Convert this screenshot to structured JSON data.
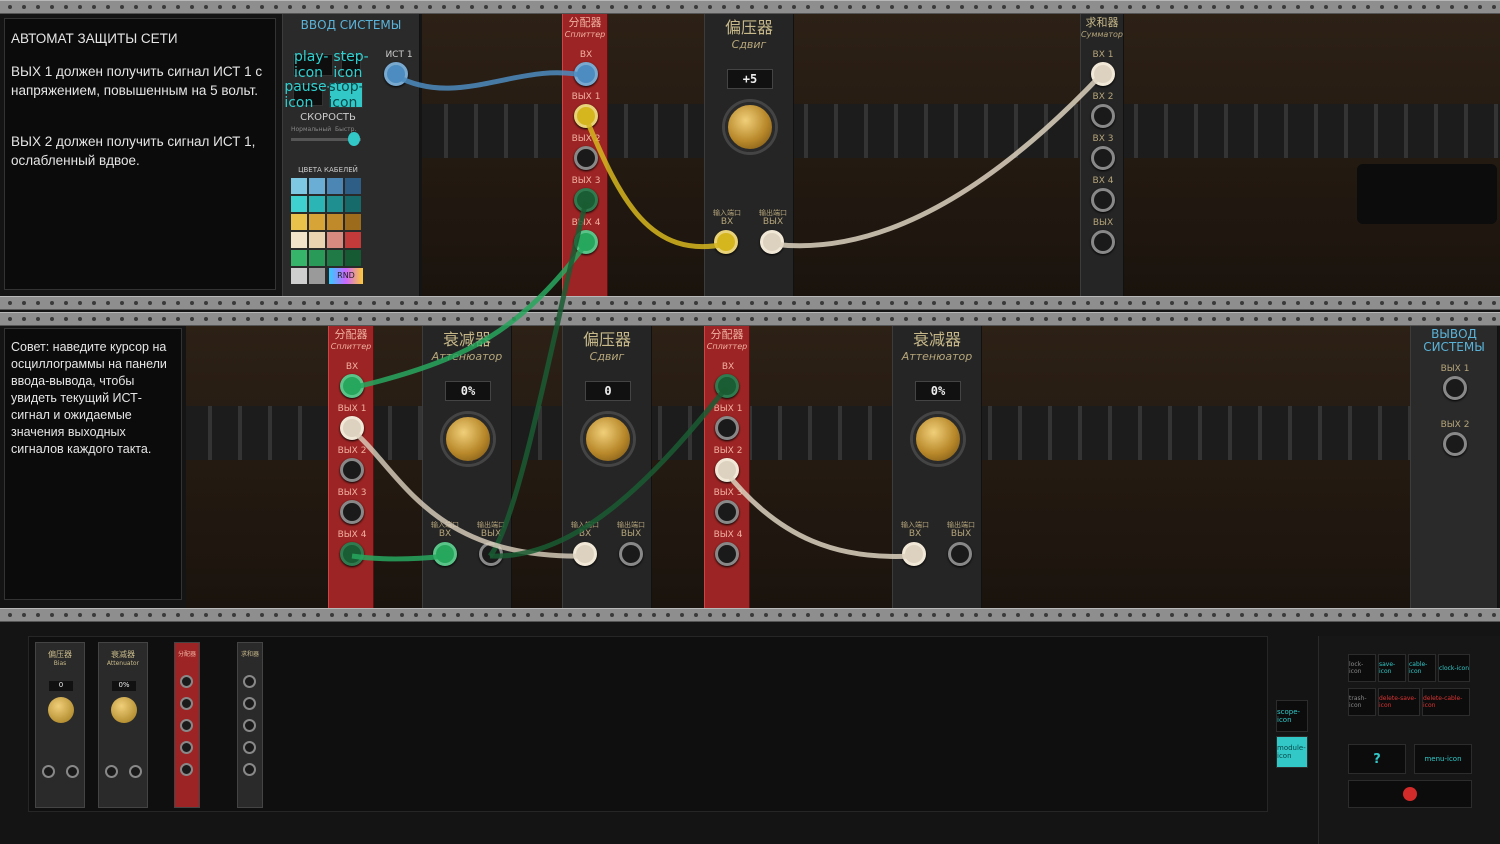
{
  "task": {
    "title": "АВТОМАТ ЗАЩИТЫ СЕТИ",
    "line1": "ВЫХ 1 должен получить сигнал ИСТ 1 с напряжением, повышенным на 5 вольт.",
    "line2": "ВЫХ 2 должен получить сигнал ИСТ 1, ослабленный вдвое."
  },
  "tip": {
    "text": "Совет: наведите курсор на осциллограммы на панели ввода-вывода, чтобы увидеть текущий ИСТ-сигнал и ожидаемые значения выходных сигналов каждого такта."
  },
  "input_panel": {
    "title": "ВВОД СИСТЕМЫ",
    "source_label": "ИСТ 1",
    "speed_label": "СКОРОСТЬ",
    "speed_min": "Нормальный",
    "speed_max": "Быстр.",
    "cable_colors_label": "ЦВЕТА КАБЕЛЕЙ",
    "rnd_label": "RND",
    "play_icon": "play-icon",
    "step_icon": "step-icon",
    "pause_icon": "pause-icon",
    "stop_icon": "stop-icon",
    "speed_fraction": 0.9
  },
  "output_panel": {
    "title": "ВЫВОД СИСТЕМЫ",
    "out1": "ВЫХ 1",
    "out2": "ВЫХ 2"
  },
  "cable_palette": [
    "#7ec8e3",
    "#6aaed6",
    "#4b86b4",
    "#2e5e86",
    "#3fd0d0",
    "#2bb5b5",
    "#1f8f8f",
    "#176a6a",
    "#e8c24a",
    "#d6a437",
    "#c08a2a",
    "#9c6b1c",
    "#f3e3c8",
    "#e8d2b0",
    "#d98a80",
    "#c23a3a",
    "#36b56a",
    "#2a9a58",
    "#1f7a46",
    "#165a34",
    "#cfcfcf",
    "#9a9a9a"
  ],
  "splitter": {
    "title": "分配器",
    "sub": "Сплиттер",
    "in": "ВХ",
    "o1": "ВЫХ 1",
    "o2": "ВЫХ 2",
    "o3": "ВЫХ 3",
    "o4": "ВЫХ 4"
  },
  "bias": {
    "title": "偏压器",
    "sub": "Сдвиг",
    "in_cn": "输入端口",
    "in": "ВХ",
    "out_cn": "输出端口",
    "out": "ВЫХ",
    "top_value": "+5",
    "bottom_value": "0"
  },
  "attenuator": {
    "title": "衰减器",
    "sub": "Аттенюатор",
    "value": "0%",
    "in_cn": "输入端口",
    "in": "ВХ",
    "out_cn": "输出端口",
    "out": "ВЫХ"
  },
  "summator": {
    "title": "求和器",
    "sub": "Сумматор",
    "in1": "ВХ 1",
    "in2": "ВХ 2",
    "in3": "ВХ 3",
    "in4": "ВХ 4",
    "out": "ВЫХ"
  },
  "palette": {
    "bias_title": "偏压器",
    "bias_sub": "Bias",
    "bias_value": "0",
    "att_title": "衰减器",
    "att_sub": "Attenuator",
    "att_value": "0%",
    "split_title": "分配器",
    "sum_title": "求和器"
  },
  "controls": {
    "lock": "lock-icon",
    "save": "save-icon",
    "cable": "cable-icon",
    "clock": "clock-icon",
    "trash": "trash-icon",
    "delete_save": "delete-save-icon",
    "delete_cable": "delete-cable-icon",
    "help": "?",
    "menu": "menu-icon",
    "record": "record-icon",
    "scope": "scope-icon",
    "module": "module-icon"
  },
  "colors": {
    "accent": "#32c8c8",
    "splitter": "#9c2424",
    "knob": "#d4a84a"
  }
}
